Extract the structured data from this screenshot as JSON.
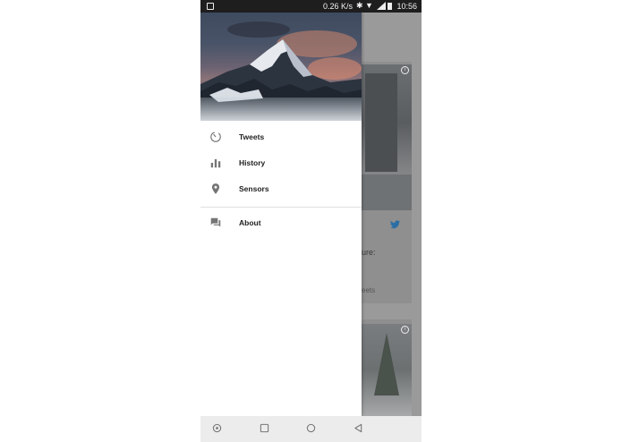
{
  "status_bar": {
    "speed": "0.26 K/s",
    "time": "10:56"
  },
  "drawer": {
    "items": [
      {
        "label": "Tweets",
        "icon": "timer-icon"
      },
      {
        "label": "History",
        "icon": "bar-chart-icon"
      },
      {
        "label": "Sensors",
        "icon": "location-pin-icon"
      }
    ],
    "secondary_items": [
      {
        "label": "About",
        "icon": "forum-icon"
      }
    ]
  },
  "background_content": {
    "text_fragment": "ure:",
    "tweets_fragment": "eets"
  },
  "colors": {
    "status_bar": "#1e1e1e",
    "twitter_blue": "#2a6ea5",
    "drawer_bg": "#ffffff",
    "icon_gray": "#757575"
  },
  "nav_bar": {
    "buttons": [
      "assistant-icon",
      "recent-apps-icon",
      "home-icon",
      "back-icon"
    ]
  }
}
